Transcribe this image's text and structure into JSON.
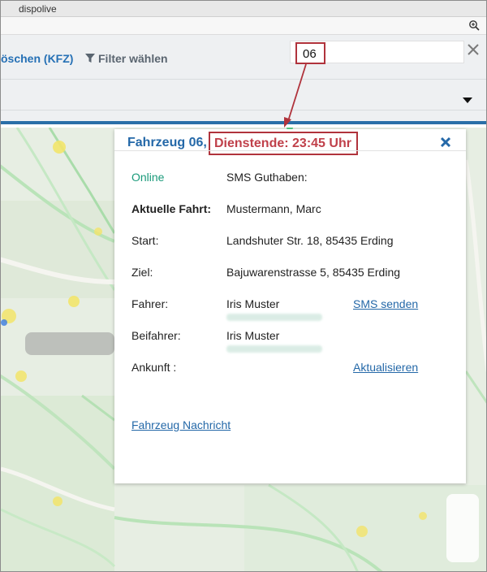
{
  "window": {
    "title": "dispolive"
  },
  "toolbar": {
    "delete_label": "öschen (KFZ)",
    "filter_label": "Filter wählen",
    "search_value": "06"
  },
  "popup": {
    "title": "Fahrzeug 06,",
    "shift_end": "Dienstende: 23:45 Uhr",
    "status": "Online",
    "sms_credit_label": "SMS Guthaben:",
    "current_trip_label": "Aktuelle Fahrt:",
    "current_trip_value": "Mustermann, Marc",
    "start_label": "Start:",
    "start_value": "Landshuter Str. 18, 85435 Erding",
    "destination_label": "Ziel:",
    "destination_value": "Bajuwarenstrasse 5, 85435 Erding",
    "driver_label": "Fahrer:",
    "driver_value": "Iris Muster",
    "send_sms_link": "SMS senden",
    "codriver_label": "Beifahrer:",
    "codriver_value": "Iris Muster",
    "arrival_label": "Ankunft :",
    "refresh_link": "Aktualisieren",
    "vehicle_message_link": "Fahrzeug Nachricht"
  },
  "colors": {
    "accent_blue": "#2468a8",
    "highlight_red": "#b0333c",
    "online_green": "#1a9a7a"
  },
  "icons": [
    "zoom-icon",
    "filter-icon",
    "close-icon",
    "chevron-down-icon",
    "close-popup-icon"
  ]
}
